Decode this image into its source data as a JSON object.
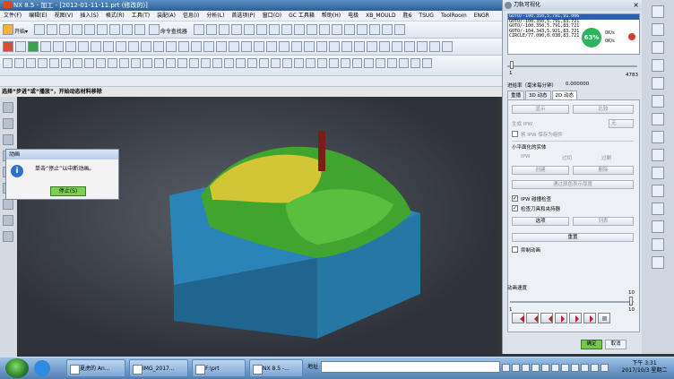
{
  "window": {
    "title": "NX 8.5 - 加工 - [2012-01-11-11.prt (修改的)]"
  },
  "menu": [
    "文件(F)",
    "编辑(E)",
    "视图(V)",
    "插入(S)",
    "格式(R)",
    "工具(T)",
    "装配(A)",
    "信息(I)",
    "分析(L)",
    "首选项(P)",
    "窗口(O)",
    "GC 工具箱",
    "帮助(H)",
    "电极",
    "XB_MOULD",
    "胜6",
    "TSUG",
    "ToolRoom",
    "ENGR"
  ],
  "toolbar": {
    "start_label": "开始▾",
    "command_finder": "命令查找器"
  },
  "prompt": "选择“步进”或“播放”，开始动态材料移除",
  "dialog": {
    "title": "动画",
    "message": "单击“停止”以中断动画。",
    "stop_button": "停止(S)"
  },
  "panel": {
    "title": "刀轨可视化",
    "toolpath_lines": [
      "GOTO/-100.350,5.791,91.006",
      "GOTO/-100.350,5.791,83.721",
      "GOTO/-100.350,5.791,83.721",
      "GOTO/-104.343,5.921,83.721",
      "CIRCLE/77.090,0.038,83.721"
    ],
    "slider_max": "4783",
    "removal_rate_label": "进给率（毫米每分钟）",
    "removal_rate_value": "0.000000",
    "tabs": [
      "重播",
      "3D 动态",
      "2D 动态"
    ],
    "active_tab": "2D 动态",
    "display_button": "显示",
    "compare_button": "比较",
    "ipw_label": "生成 IPW",
    "ipw_value": "无",
    "save_ipw_label": "将 IPW 保存为组件",
    "small_faceted_body_label": "小平面化的实体",
    "radio_ipw": "IPW",
    "radio_over": "过切",
    "radio_over2": "过剩",
    "create_button": "创建",
    "delete_button": "删除",
    "color_thickness_button": "通过颜色表示厚度",
    "ipw_collision_check": "IPW 碰撞检查",
    "check_tool_holder": "检查刀具和夹持器",
    "options_button": "选项",
    "list_button": "列表",
    "reset_button": "重置",
    "suppress_animation": "抑制动画",
    "anim_speed_label": "动画速度",
    "speed_min": "1",
    "speed_max": "10",
    "ok_button": "确定",
    "cancel_button": "取消"
  },
  "network": {
    "percent": "63%",
    "up": "0K/s",
    "down": "0K/s"
  },
  "taskbar": {
    "items": [
      "夏虎的 An...",
      "IMG_2017...",
      "F:\\prt",
      "NX 8.5 -..."
    ],
    "address_label": "地址",
    "time": "下午 3:31",
    "date": "2017/10/3 星期二"
  },
  "colors": {
    "accent_green": "#7dd04f",
    "title_blue": "#2b5f95",
    "part_blue": "#2d7fb4",
    "part_green": "#4aa832",
    "part_yellow": "#d6c83a"
  }
}
